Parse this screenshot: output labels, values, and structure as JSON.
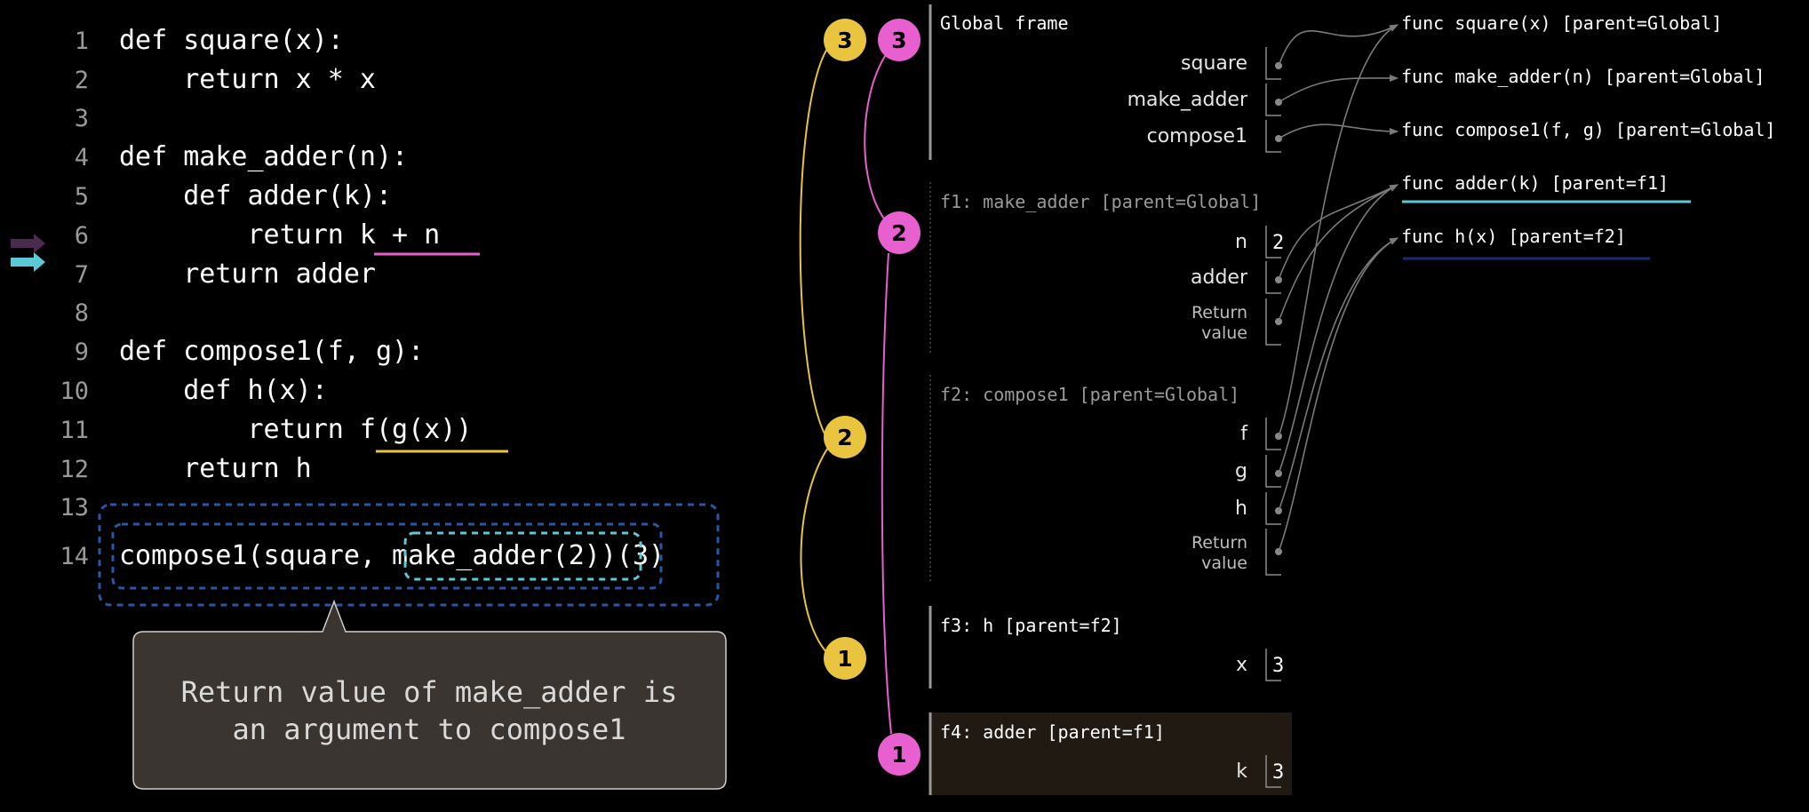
{
  "code": {
    "lines": [
      {
        "num": "1",
        "text": "def square(x):"
      },
      {
        "num": "2",
        "text": "    return x * x"
      },
      {
        "num": "3",
        "text": ""
      },
      {
        "num": "4",
        "text": "def make_adder(n):"
      },
      {
        "num": "5",
        "text": "    def adder(k):"
      },
      {
        "num": "6",
        "text": "        return k + n"
      },
      {
        "num": "7",
        "text": "    return adder"
      },
      {
        "num": "8",
        "text": ""
      },
      {
        "num": "9",
        "text": "def compose1(f, g):"
      },
      {
        "num": "10",
        "text": "    def h(x):"
      },
      {
        "num": "11",
        "text": "        return f(g(x))"
      },
      {
        "num": "12",
        "text": "    return h"
      },
      {
        "num": "13",
        "text": ""
      },
      {
        "num": "14",
        "text": "compose1(square, make_adder(2))(3)"
      }
    ]
  },
  "callout": {
    "line1": "Return value of make_adder is",
    "line2": "an argument to compose1"
  },
  "frames": [
    {
      "title": "Global frame",
      "rows": [
        {
          "name": "square",
          "kind": "pointer"
        },
        {
          "name": "make_adder",
          "kind": "pointer"
        },
        {
          "name": "compose1",
          "kind": "pointer"
        }
      ]
    },
    {
      "title": "f1: make_adder [parent=Global]",
      "rows": [
        {
          "name": "n",
          "kind": "value",
          "value": "2"
        },
        {
          "name": "adder",
          "kind": "pointer"
        },
        {
          "name": "Return\nvalue",
          "kind": "pointer"
        }
      ]
    },
    {
      "title": "f2: compose1 [parent=Global]",
      "rows": [
        {
          "name": "f",
          "kind": "pointer"
        },
        {
          "name": "g",
          "kind": "pointer"
        },
        {
          "name": "h",
          "kind": "pointer"
        },
        {
          "name": "Return\nvalue",
          "kind": "pointer"
        }
      ]
    },
    {
      "title": "f3: h [parent=f2]",
      "rows": [
        {
          "name": "x",
          "kind": "value",
          "value": "3"
        }
      ]
    },
    {
      "title": "f4: adder [parent=f1]",
      "rows": [
        {
          "name": "k",
          "kind": "value",
          "value": "3"
        }
      ]
    }
  ],
  "functions": [
    {
      "label": "func square(x) [parent=Global]"
    },
    {
      "label": "func make_adder(n) [parent=Global]"
    },
    {
      "label": "func compose1(f, g) [parent=Global]"
    },
    {
      "label": "func adder(k) [parent=f1]"
    },
    {
      "label": "func h(x) [parent=f2]"
    }
  ],
  "call_markers": {
    "yellow": [
      "3",
      "2",
      "1"
    ],
    "pink": [
      "3",
      "2",
      "1"
    ]
  },
  "colors": {
    "background": "#000000",
    "code_text": "#ffffff",
    "line_number": "#9a9a9a",
    "yellow": "#e9c43f",
    "pink": "#e85fd0",
    "cyan": "#5cc9d6",
    "navy": "#2a56a8",
    "dark_navy": "#1c2a7a",
    "frame_title": "#ffffff",
    "frame_title_dim": "#9a9a9a",
    "arrow_gray": "#7a7a7a",
    "callout_bg": "#3a3530",
    "callout_border": "#cfcfcf",
    "callout_text": "#d9d9d9",
    "current_frame_bg": "#201a12"
  }
}
